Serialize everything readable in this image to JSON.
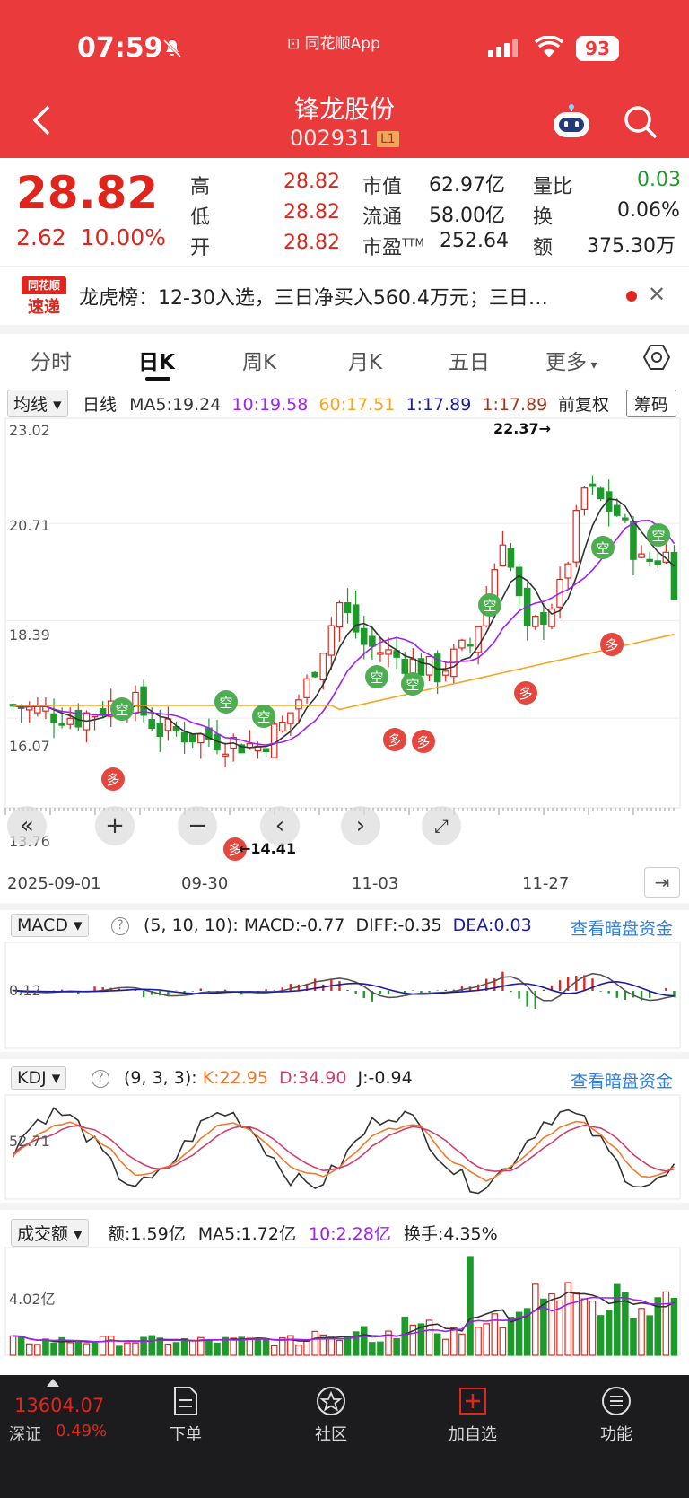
{
  "status": {
    "time": "07:59",
    "app_name": "同花顺App",
    "battery": "93"
  },
  "header": {
    "title": "锋龙股份",
    "code": "002931",
    "level_badge": "L1"
  },
  "quote": {
    "price": "28.82",
    "change": "2.62",
    "change_pct": "10.00%",
    "high_label": "高",
    "high": "28.82",
    "low_label": "低",
    "low": "28.82",
    "open_label": "开",
    "open": "28.82",
    "mktcap_label": "市值",
    "mktcap": "62.97亿",
    "float_label": "流通",
    "float": "58.00亿",
    "pe_label": "市盈",
    "pe_sup": "TTM",
    "pe": "252.64",
    "volratio_label": "量比",
    "volratio": "0.03",
    "turnover_label": "换",
    "turnover": "0.06%",
    "amount_label": "额",
    "amount": "375.30万"
  },
  "news": {
    "logo_top": "同花顺",
    "logo_bottom": "速递",
    "text": "龙虎榜：12-30入选，三日净买入560.4万元；三日…"
  },
  "tabs": [
    "分时",
    "日K",
    "周K",
    "月K",
    "五日",
    "更多"
  ],
  "active_tab": "日K",
  "ma_row": {
    "dropdown": "均线",
    "period": "日线",
    "ma5": "MA5:19.24",
    "ma10": "10:19.58",
    "ma60": "60:17.51",
    "ma1a": "1:17.89",
    "ma1b": "1:17.89",
    "adjust": "前复权",
    "chips": "筹码"
  },
  "kline": {
    "y_labels": [
      "23.02",
      "20.71",
      "18.39",
      "16.07",
      "13.76"
    ],
    "max_label": "22.37→",
    "min_label": "←14.41",
    "dates": [
      "2025-09-01",
      "09-30",
      "11-03",
      "11-27"
    ],
    "signal_kong": "空",
    "signal_duo": "多",
    "ymin": 13.76,
    "ymax": 23.02
  },
  "macd": {
    "dropdown": "MACD",
    "params": "(5, 10, 10):",
    "macd": "MACD:-0.77",
    "diff": "DIFF:-0.35",
    "dea": "DEA:0.03",
    "link": "查看暗盘资金",
    "level_label": "0.12"
  },
  "kdj": {
    "dropdown": "KDJ",
    "params": "(9, 3, 3):",
    "k": "K:22.95",
    "d": "D:34.90",
    "j": "J:-0.94",
    "link": "查看暗盘资金",
    "level_label": "52.71"
  },
  "volume": {
    "dropdown": "成交额",
    "amount": "额:1.59亿",
    "ma5": "MA5:1.72亿",
    "ma10": "10:2.28亿",
    "turnover": "换手:4.35%",
    "level_label": "4.02亿"
  },
  "bottom": {
    "index_value": "13604.07",
    "index_name": "深证",
    "index_pct": "0.49%",
    "nav": [
      "下单",
      "社区",
      "加自选",
      "功能"
    ]
  },
  "colors": {
    "header": "#ea3a3c",
    "up": "#e0261c",
    "down": "#1e9a2d",
    "ma5": "#333333",
    "ma10": "#a020f0",
    "ma60": "#f5a623",
    "dea": "#1c1ca0"
  }
}
